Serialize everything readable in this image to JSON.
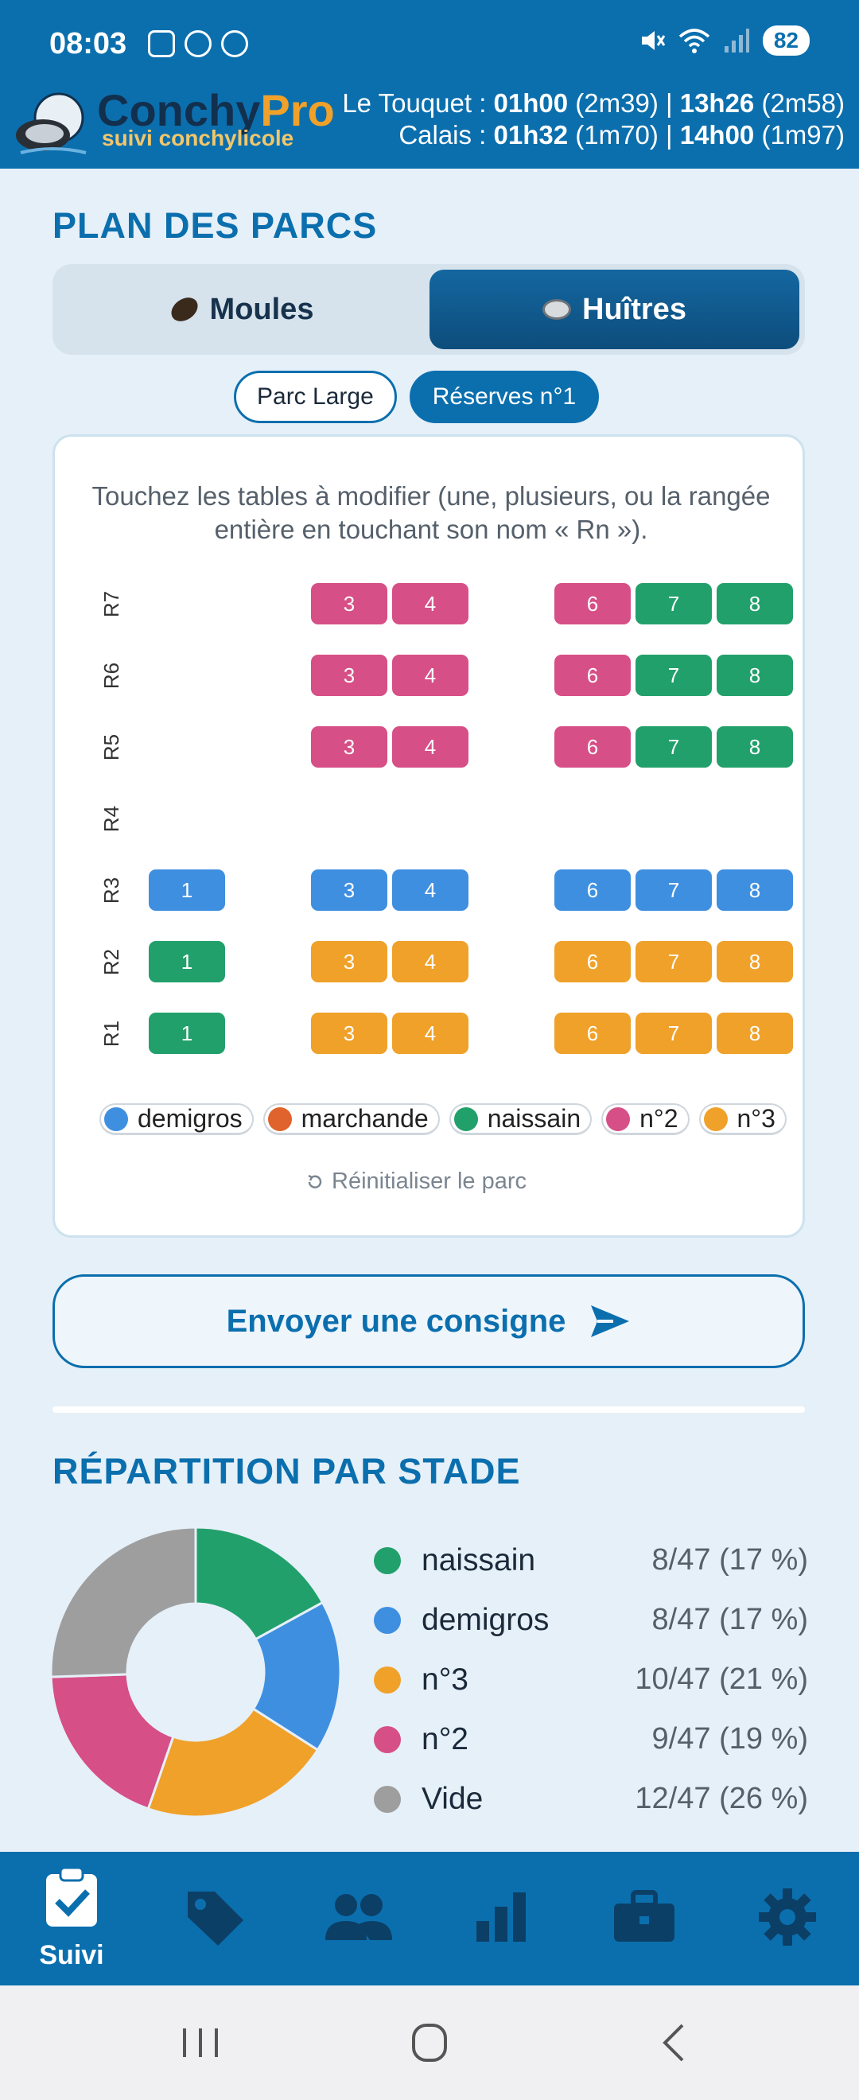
{
  "status_bar": {
    "time": "08:03",
    "battery": "82"
  },
  "header": {
    "brand_main": "Conchy",
    "brand_accent": "Pro",
    "brand_sub": "suivi conchylicole",
    "tide_line1": {
      "place": "Le Touquet : ",
      "t1": "01h00",
      "h1": " (2m39) | ",
      "t2": "13h26",
      "h2": " (2m58)"
    },
    "tide_line2": {
      "place": "Calais : ",
      "t1": "01h32",
      "h1": " (1m70) | ",
      "t2": "14h00",
      "h2": " (1m97)"
    }
  },
  "plan": {
    "title": "PLAN DES PARCS",
    "tabs": [
      {
        "label": "Moules",
        "active": false
      },
      {
        "label": "Huîtres",
        "active": true
      }
    ],
    "parcs": [
      {
        "label": "Parc Large",
        "active": false
      },
      {
        "label": "Réserves n°1",
        "active": true
      }
    ],
    "instruction": "Touchez les tables à modifier (une, plusieurs, ou la rangée entière en touchant son nom « Rn »).",
    "rows": [
      {
        "name": "R7",
        "tables": [
          {
            "n": "3",
            "c": "pink"
          },
          {
            "n": "4",
            "c": "pink"
          },
          {
            "n": "6",
            "c": "pink"
          },
          {
            "n": "7",
            "c": "green"
          },
          {
            "n": "8",
            "c": "green"
          }
        ]
      },
      {
        "name": "R6",
        "tables": [
          {
            "n": "3",
            "c": "pink"
          },
          {
            "n": "4",
            "c": "pink"
          },
          {
            "n": "6",
            "c": "pink"
          },
          {
            "n": "7",
            "c": "green"
          },
          {
            "n": "8",
            "c": "green"
          }
        ]
      },
      {
        "name": "R5",
        "tables": [
          {
            "n": "3",
            "c": "pink"
          },
          {
            "n": "4",
            "c": "pink"
          },
          {
            "n": "6",
            "c": "pink"
          },
          {
            "n": "7",
            "c": "green"
          },
          {
            "n": "8",
            "c": "green"
          }
        ]
      },
      {
        "name": "R4",
        "tables": []
      },
      {
        "name": "R3",
        "tables": [
          {
            "n": "1",
            "c": "blue"
          },
          {
            "n": "3",
            "c": "blue"
          },
          {
            "n": "4",
            "c": "blue"
          },
          {
            "n": "6",
            "c": "blue"
          },
          {
            "n": "7",
            "c": "blue"
          },
          {
            "n": "8",
            "c": "blue"
          }
        ]
      },
      {
        "name": "R2",
        "tables": [
          {
            "n": "1",
            "c": "green"
          },
          {
            "n": "3",
            "c": "orange"
          },
          {
            "n": "4",
            "c": "orange"
          },
          {
            "n": "6",
            "c": "orange"
          },
          {
            "n": "7",
            "c": "orange"
          },
          {
            "n": "8",
            "c": "orange"
          }
        ]
      },
      {
        "name": "R1",
        "tables": [
          {
            "n": "1",
            "c": "green"
          },
          {
            "n": "3",
            "c": "orange"
          },
          {
            "n": "4",
            "c": "orange"
          },
          {
            "n": "6",
            "c": "orange"
          },
          {
            "n": "7",
            "c": "orange"
          },
          {
            "n": "8",
            "c": "orange"
          }
        ]
      }
    ],
    "legend": [
      {
        "label": "demigros",
        "color": "#3f8fe0"
      },
      {
        "label": "marchande",
        "color": "#e0622c"
      },
      {
        "label": "naissain",
        "color": "#22a06b"
      },
      {
        "label": "n°2",
        "color": "#d64f86"
      },
      {
        "label": "n°3",
        "color": "#f0a12a"
      }
    ],
    "reset_label": "Réinitialiser le parc"
  },
  "send_button": "Envoyer une consigne",
  "repartition": {
    "title": "RÉPARTITION PAR STADE",
    "items": [
      {
        "label": "naissain",
        "count": "8/47",
        "pct": "(17 %)",
        "color": "#22a06b"
      },
      {
        "label": "demigros",
        "count": "8/47",
        "pct": "(17 %)",
        "color": "#3f8fe0"
      },
      {
        "label": "n°3",
        "count": "10/47",
        "pct": "(21 %)",
        "color": "#f0a12a"
      },
      {
        "label": "n°2",
        "count": "9/47",
        "pct": "(19 %)",
        "color": "#d64f86"
      },
      {
        "label": "Vide",
        "count": "12/47",
        "pct": "(26 %)",
        "color": "#9e9e9e"
      }
    ]
  },
  "chart_data": {
    "type": "pie",
    "categories": [
      "naissain",
      "demigros",
      "n°3",
      "n°2",
      "Vide"
    ],
    "values": [
      8,
      8,
      10,
      9,
      12
    ],
    "colors": [
      "#22a06b",
      "#3f8fe0",
      "#f0a12a",
      "#d64f86",
      "#9e9e9e"
    ]
  },
  "bottom_nav": [
    {
      "label": "Suivi",
      "icon": "clipboard-check-icon",
      "active": true
    },
    {
      "label": "",
      "icon": "tag-icon",
      "active": false
    },
    {
      "label": "",
      "icon": "people-icon",
      "active": false
    },
    {
      "label": "",
      "icon": "bar-chart-icon",
      "active": false
    },
    {
      "label": "",
      "icon": "briefcase-icon",
      "active": false
    },
    {
      "label": "",
      "icon": "gear-icon",
      "active": false
    }
  ]
}
